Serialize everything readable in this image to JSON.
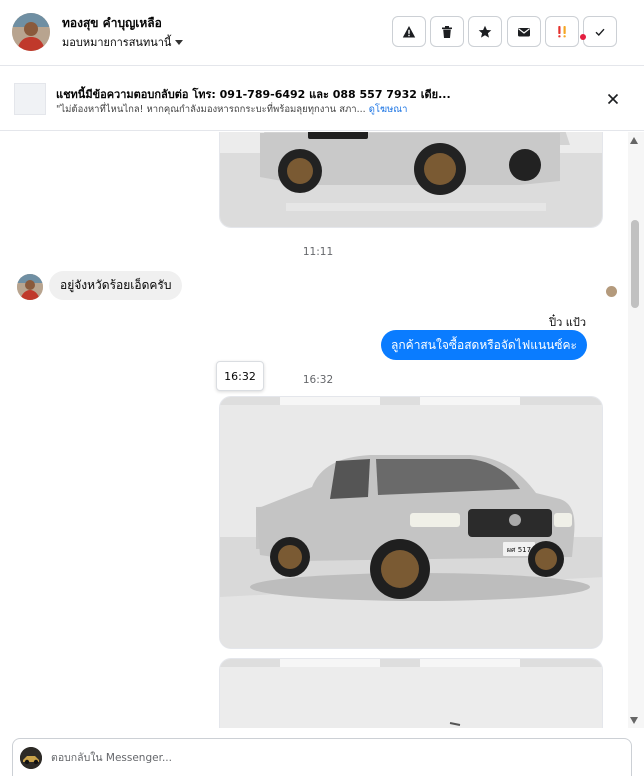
{
  "header": {
    "contact_name": "ทองสุข คำบุญเหลือ",
    "assign_label": "มอบหมายการสนทนานี้",
    "actions": [
      {
        "name": "report-button",
        "icon": "warning-icon"
      },
      {
        "name": "delete-button",
        "icon": "trash-icon"
      },
      {
        "name": "star-button",
        "icon": "star-icon"
      },
      {
        "name": "mark-unread-button",
        "icon": "envelope-icon"
      },
      {
        "name": "mark-spam-button",
        "icon": "exclamation-icon"
      },
      {
        "name": "mark-done-button",
        "icon": "check-icon"
      }
    ]
  },
  "banner": {
    "title": "แชทนี้มีข้อความตอบกลับต่อ โทร: 091-789-6492 และ 088 557 7932 เดีย...",
    "subtitle": "\"ไม่ต้องหาที่ไหนไกล! หากคุณกำลังมองหารถกระบะที่พร้อมลุยทุกงาน สภา...",
    "link": "ดูโฆษณา"
  },
  "conversation": {
    "timestamps": [
      "11:11",
      "16:32"
    ],
    "incoming_message": "อยู่จังหวัดร้อยเอ็ดครับ",
    "outgoing_sender": "ปิ๋ว แป้ว",
    "outgoing_message": "ลูกค้าสนใจซื้อสดหรือจัดไฟแนนซ์คะ",
    "tooltip_time": "16:32",
    "car_plate": "ผศ 517"
  },
  "composer": {
    "placeholder": "ตอบกลับใน Messenger..."
  },
  "colors": {
    "accent": "#0a7cff",
    "incoming_bubble": "#f0f0f0",
    "spam_icon": "#e4312d",
    "link": "#1b74e4"
  }
}
